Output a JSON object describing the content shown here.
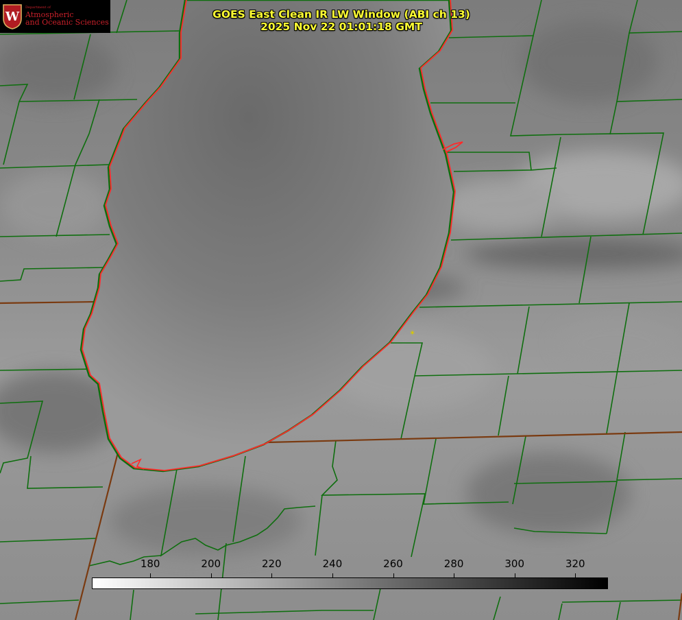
{
  "header": {
    "title_line1": "GOES East Clean IR LW Window (ABI ch 13)",
    "title_line2": "2025 Nov 22 01:01:18 GMT"
  },
  "logo": {
    "department": "Department of",
    "line1": "Atmospheric",
    "line2": "and Oceanic Sciences",
    "seal_letter": "W"
  },
  "colorbar": {
    "ticks": [
      "180",
      "200",
      "220",
      "240",
      "260",
      "280",
      "300",
      "320"
    ],
    "tick_values": [
      180,
      200,
      220,
      240,
      260,
      280,
      300,
      320
    ],
    "range": [
      161,
      331
    ],
    "gradient": [
      "#ffffff",
      "#000000"
    ]
  },
  "map_styles": {
    "county_color": "#0e6e0e",
    "state_border_color": "#7a3a10",
    "lake_shore_color": "#ff2a2a",
    "title_color": "#ffff33"
  }
}
